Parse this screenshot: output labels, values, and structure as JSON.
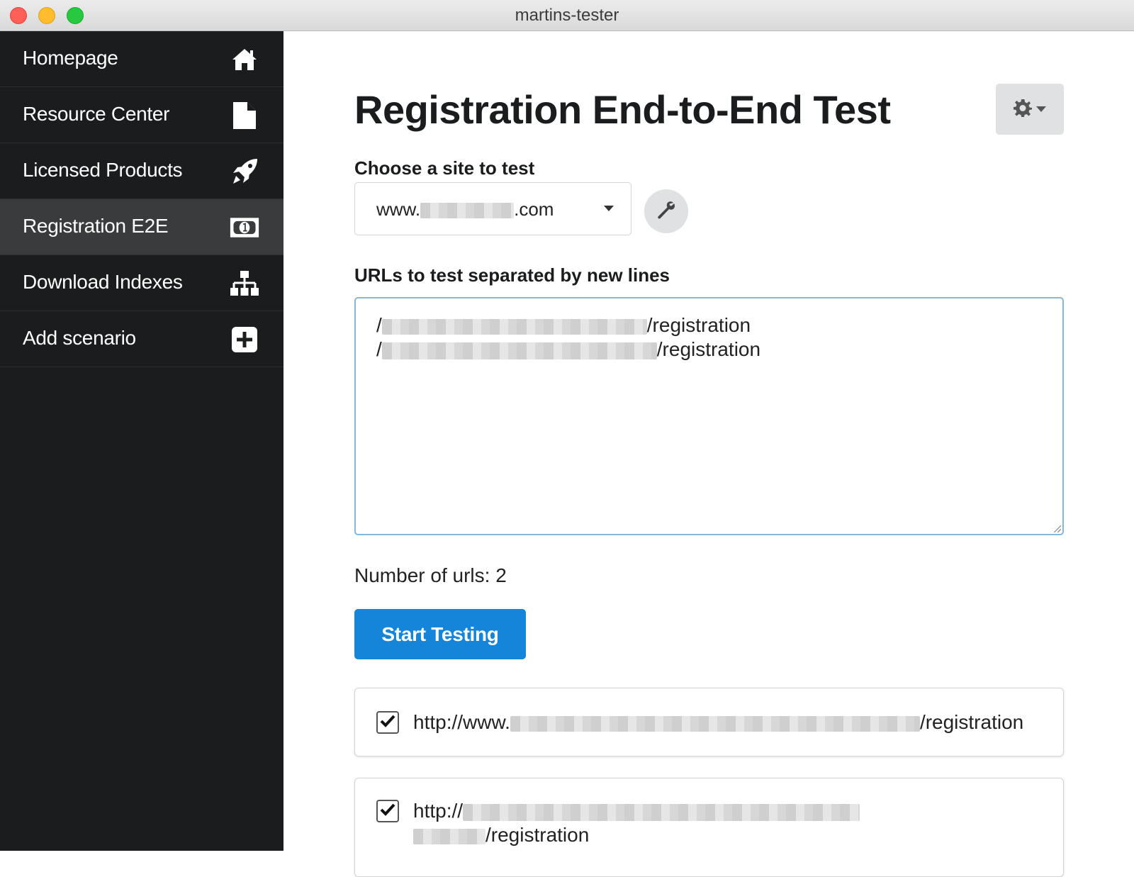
{
  "window": {
    "title": "martins-tester"
  },
  "sidebar": {
    "items": [
      {
        "label": "Homepage",
        "icon": "home-icon"
      },
      {
        "label": "Resource Center",
        "icon": "file-icon"
      },
      {
        "label": "Licensed Products",
        "icon": "rocket-icon"
      },
      {
        "label": "Registration E2E",
        "icon": "money-icon",
        "active": true
      },
      {
        "label": "Download Indexes",
        "icon": "sitemap-icon"
      },
      {
        "label": "Add scenario",
        "icon": "plus-square-icon"
      }
    ]
  },
  "main": {
    "title": "Registration End-to-End Test",
    "settings_icon": "gear-icon",
    "site_label": "Choose a site to test",
    "site_value_prefix": "www.",
    "site_value_suffix": ".com",
    "urls_label": "URLs to test separated by new lines",
    "url_lines": [
      {
        "prefix": "/",
        "suffix": "/registration"
      },
      {
        "prefix": "/",
        "suffix": "/registration"
      }
    ],
    "count_label": "Number of urls:",
    "count_value": "2",
    "start_button": "Start Testing",
    "results": [
      {
        "prefix": "http://www.",
        "suffix": "/registration",
        "checked": true
      },
      {
        "prefix": "http://",
        "suffix": "/registration",
        "checked": true
      }
    ]
  },
  "colors": {
    "sidebar_bg": "#1b1c1d",
    "sidebar_active": "#3a3b3c",
    "primary": "#1485d8",
    "textarea_focus": "#85b7d9"
  }
}
